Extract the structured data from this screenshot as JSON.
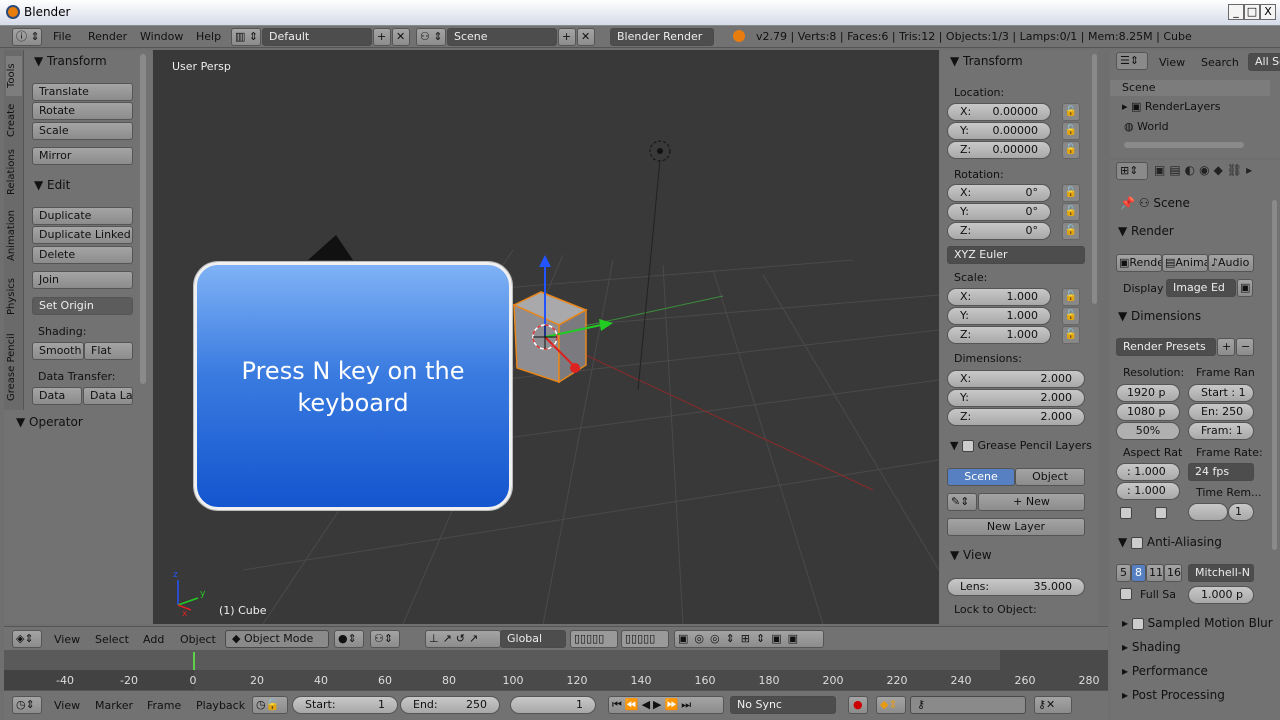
{
  "window": {
    "title": "Blender",
    "min": "_",
    "max": "□",
    "close": "X"
  },
  "menu": {
    "items": [
      "File",
      "Render",
      "Window",
      "Help"
    ],
    "layout": "Default",
    "scene": "Scene",
    "engine": "Blender Render",
    "stats": "v2.79 | Verts:8 | Faces:6 | Tris:12 | Objects:1/3 | Lamps:0/1 | Mem:8.25M | Cube"
  },
  "toolshelf": {
    "tabs": [
      "Tools",
      "Create",
      "Relations",
      "Animation",
      "Physics",
      "Grease Pencil"
    ],
    "transform_header": "Transform",
    "translate": "Translate",
    "rotate": "Rotate",
    "scale": "Scale",
    "mirror": "Mirror",
    "edit_header": "Edit",
    "duplicate": "Duplicate",
    "duplicate_linked": "Duplicate Linked",
    "delete": "Delete",
    "join": "Join",
    "set_origin": "Set Origin",
    "shading_label": "Shading:",
    "smooth": "Smooth",
    "flat": "Flat",
    "data_transfer_label": "Data Transfer:",
    "data": "Data",
    "data_la": "Data La",
    "operator_header": "Operator"
  },
  "viewport": {
    "view_name": "User Persp",
    "object_label": "(1) Cube"
  },
  "callout": {
    "text": "Press N key on the keyboard"
  },
  "npanel": {
    "transform_header": "Transform",
    "location_label": "Location:",
    "location": [
      {
        "axis": "X:",
        "value": "0.00000"
      },
      {
        "axis": "Y:",
        "value": "0.00000"
      },
      {
        "axis": "Z:",
        "value": "0.00000"
      }
    ],
    "rotation_label": "Rotation:",
    "rotation": [
      {
        "axis": "X:",
        "value": "0°"
      },
      {
        "axis": "Y:",
        "value": "0°"
      },
      {
        "axis": "Z:",
        "value": "0°"
      }
    ],
    "rotation_mode": "XYZ Euler",
    "scale_label": "Scale:",
    "scale": [
      {
        "axis": "X:",
        "value": "1.000"
      },
      {
        "axis": "Y:",
        "value": "1.000"
      },
      {
        "axis": "Z:",
        "value": "1.000"
      }
    ],
    "dimensions_label": "Dimensions:",
    "dimensions": [
      {
        "axis": "X:",
        "value": "2.000"
      },
      {
        "axis": "Y:",
        "value": "2.000"
      },
      {
        "axis": "Z:",
        "value": "2.000"
      }
    ],
    "grease_header": "Grease Pencil Layers",
    "scene_tab": "Scene",
    "object_tab": "Object",
    "new": "New",
    "new_layer": "New Layer",
    "view_header": "View",
    "lens_label": "Lens:",
    "lens_value": "35.000",
    "lock_label": "Lock to Object:"
  },
  "outliner": {
    "view": "View",
    "search": "Search",
    "all_scenes": "All Sc",
    "items": [
      "Scene",
      "RenderLayers",
      "World"
    ]
  },
  "properties": {
    "scene": "Scene",
    "render_header": "Render",
    "render_btn": "Rende",
    "anim_btn": "Anima",
    "audio_btn": "Audio",
    "display_label": "Display",
    "display_value": "Image Ed",
    "dimensions_header": "Dimensions",
    "render_presets": "Render Presets",
    "resolution_label": "Resolution:",
    "frame_range_label": "Frame Ran",
    "res_x": "1920 p",
    "res_y": "1080 p",
    "res_pct": "50%",
    "start": "Start : 1",
    "end": "En: 250",
    "frame": "Fram: 1",
    "aspect_label": "Aspect Rat",
    "frame_rate_label": "Frame Rate:",
    "aspect_x": ": 1.000",
    "aspect_y": ": 1.000",
    "fps": "24 fps",
    "time_rem_label": "Time Rem...",
    "time_rem_val": "1",
    "aa_header": "Anti-Aliasing",
    "aa_levels": [
      "5",
      "8",
      "11",
      "16"
    ],
    "aa_filter": "Mitchell-N",
    "full_sample": "Full Sa",
    "filter_size": "1.000 p",
    "sampled_motion_blur": "Sampled Motion Blur",
    "shading": "Shading",
    "performance": "Performance",
    "post_processing": "Post Processing"
  },
  "viewheader": {
    "view": "View",
    "select": "Select",
    "add": "Add",
    "object": "Object",
    "mode": "Object Mode",
    "orientation": "Global"
  },
  "timeline": {
    "ticks": [
      "-40",
      "-20",
      "0",
      "20",
      "40",
      "60",
      "80",
      "100",
      "120",
      "140",
      "160",
      "180",
      "200",
      "220",
      "240",
      "260",
      "280"
    ],
    "current_frame": 0
  },
  "timeline_header": {
    "view": "View",
    "marker": "Marker",
    "frame": "Frame",
    "playback": "Playback",
    "start_label": "Start:",
    "start_val": "1",
    "end_label": "End:",
    "end_val": "250",
    "current": "1",
    "sync": "No Sync"
  }
}
